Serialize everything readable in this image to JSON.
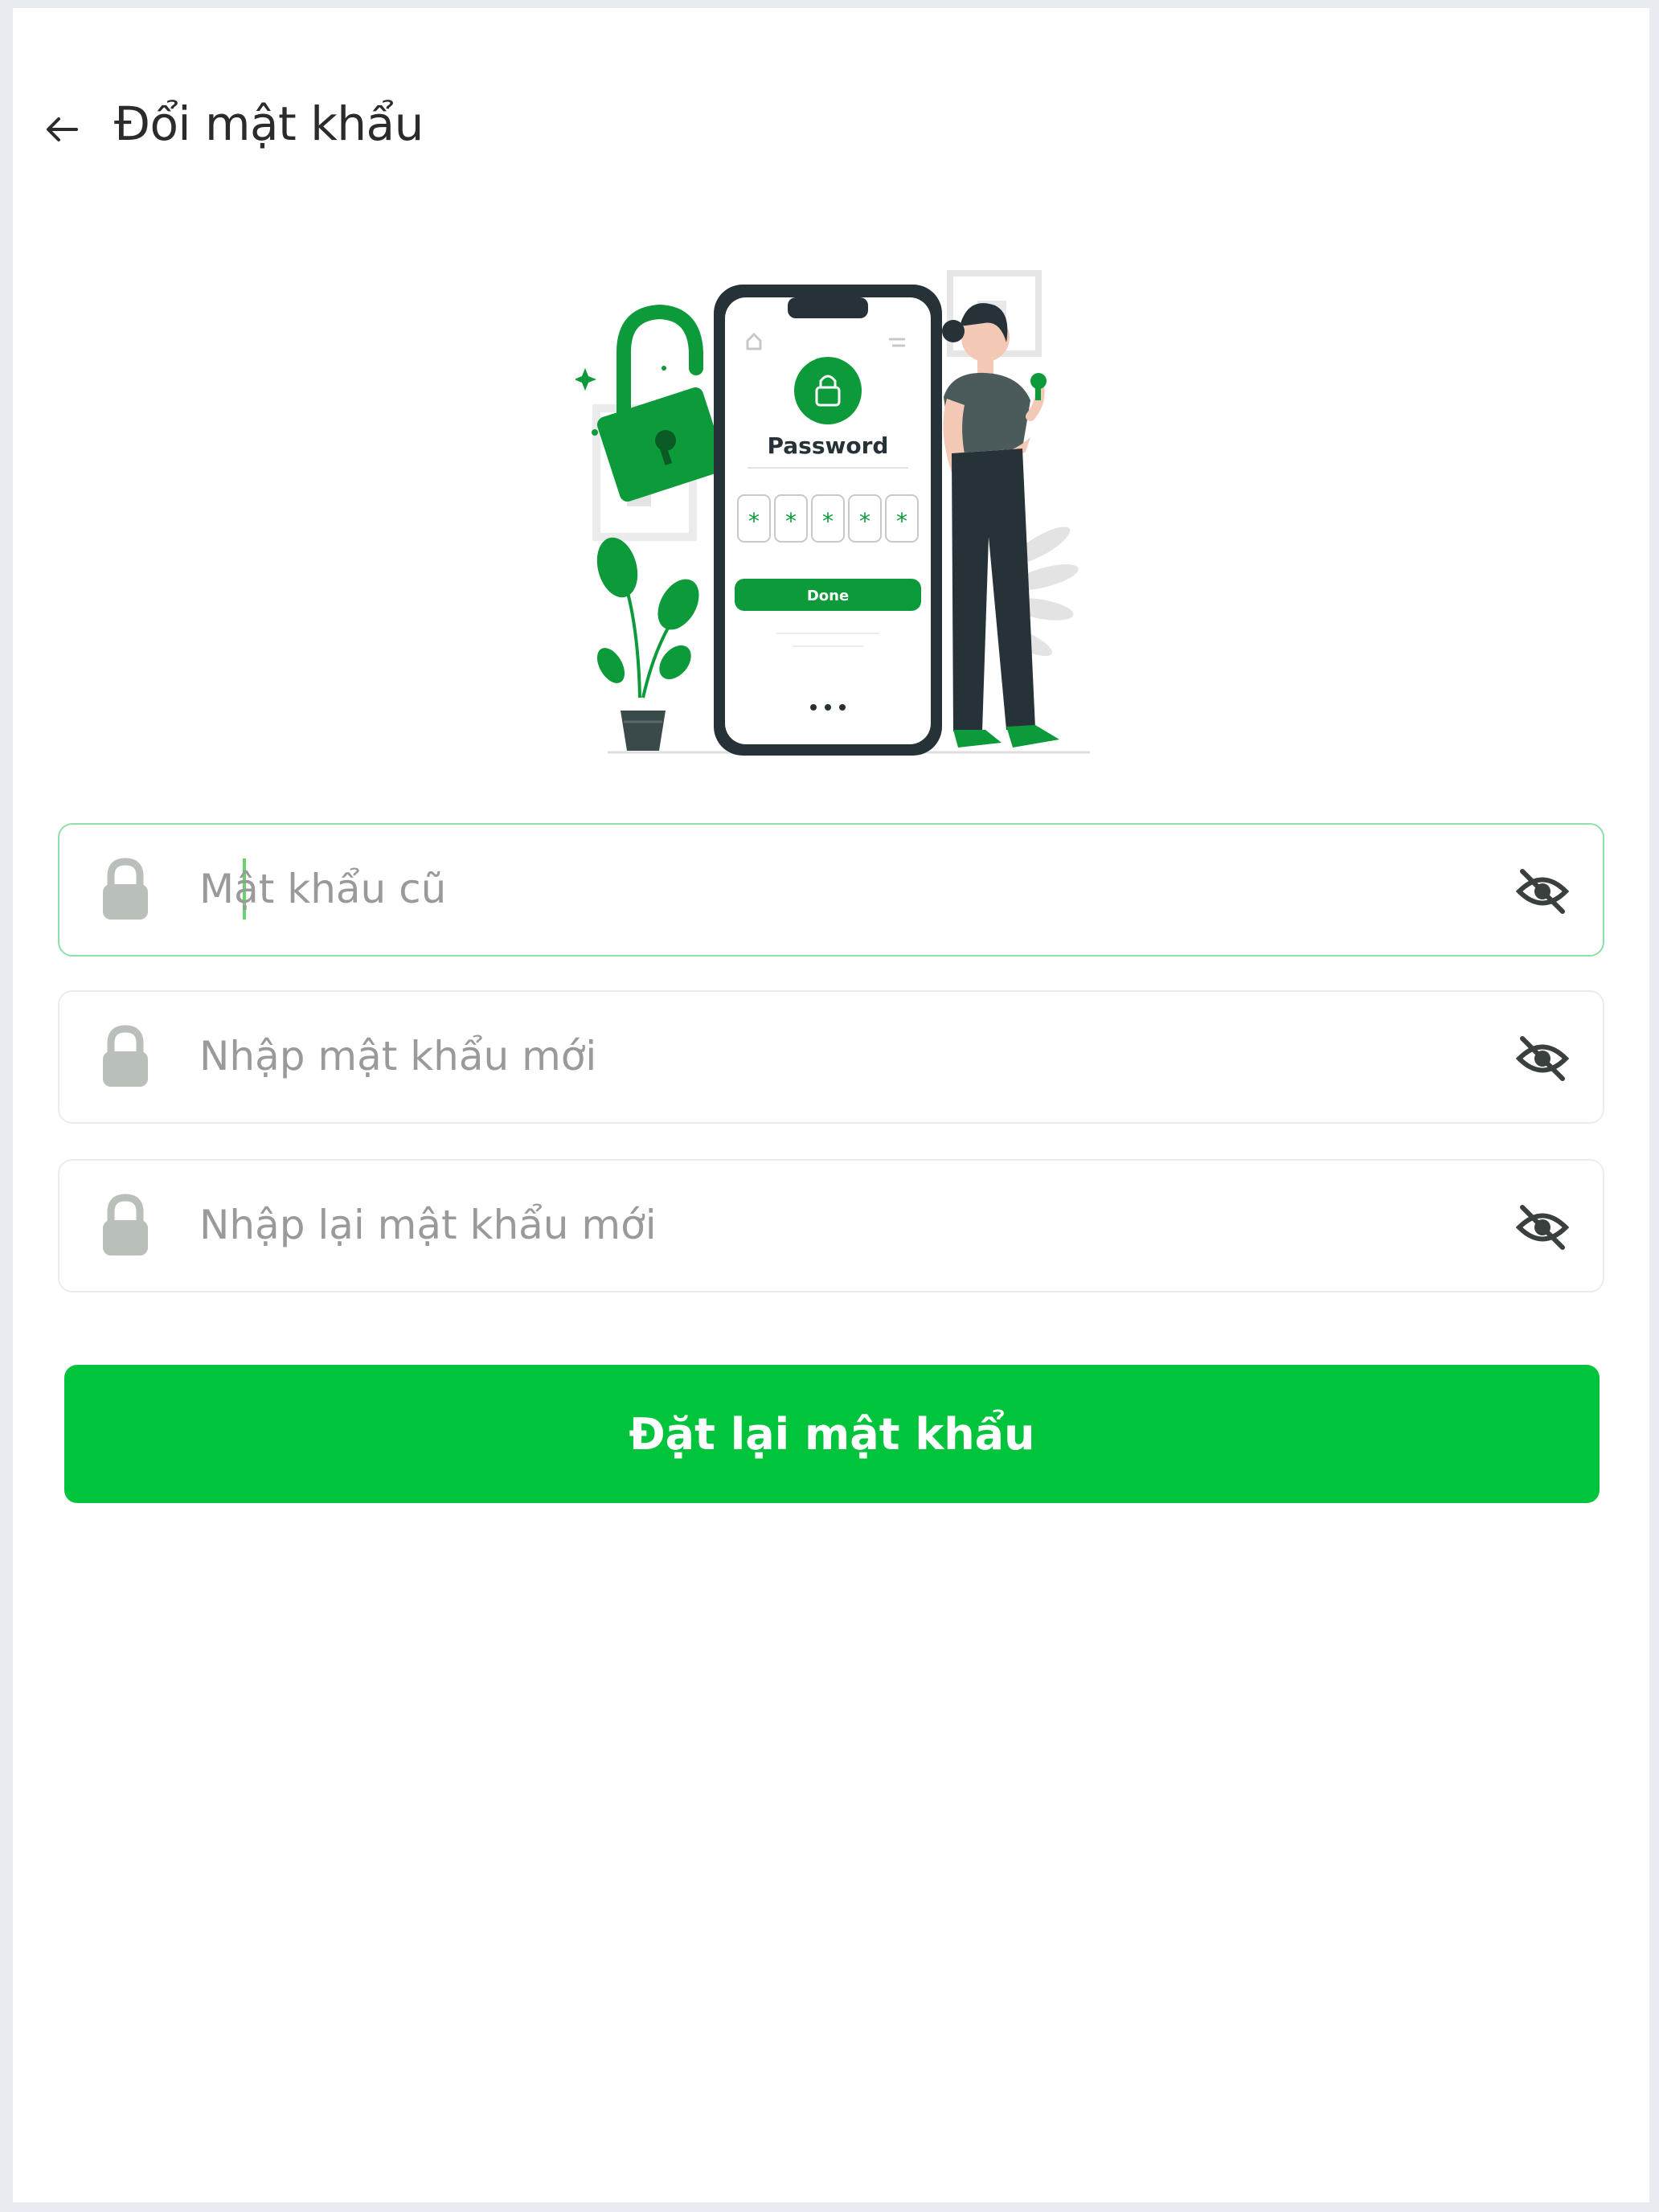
{
  "header": {
    "title": "Đổi mật khẩu",
    "back_icon": "arrow-left-icon"
  },
  "illustration": {
    "phone_heading": "Password",
    "phone_button": "Done",
    "pin_chars": [
      "*",
      "*",
      "*",
      "*",
      "*"
    ],
    "accent_color": "#0d9a3a"
  },
  "form": {
    "fields": [
      {
        "placeholder": "Mật khẩu cũ",
        "value": "",
        "icon": "lock-icon",
        "toggle_icon": "eye-off-icon",
        "focused": true
      },
      {
        "placeholder": "Nhập mật khẩu mới",
        "value": "",
        "icon": "lock-icon",
        "toggle_icon": "eye-off-icon",
        "focused": false
      },
      {
        "placeholder": "Nhập lại mật khẩu mới",
        "value": "",
        "icon": "lock-icon",
        "toggle_icon": "eye-off-icon",
        "focused": false
      }
    ],
    "submit_label": "Đặt lại mật khẩu"
  },
  "colors": {
    "primary": "#00c43c",
    "icon_gray": "#b9bfb9",
    "border": "#ececec",
    "focus_border": "#8fe0a6"
  }
}
